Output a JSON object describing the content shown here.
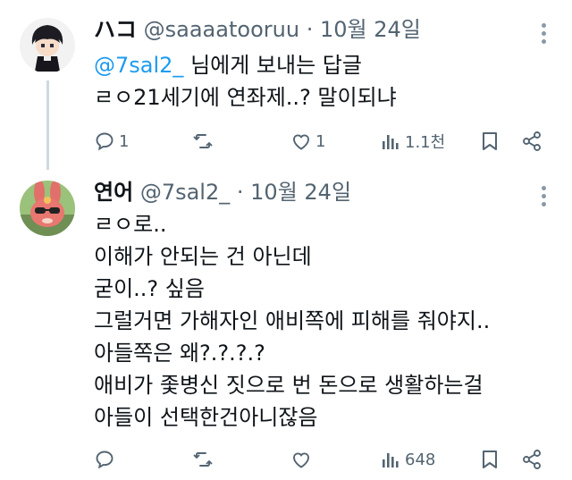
{
  "tweet1": {
    "name": "ハコ",
    "handle": "@saaaatooruu",
    "separator": "·",
    "date": "10월 24일",
    "reply_to_handle": "@7sal2_",
    "reply_to_suffix": "님에게 보내는 답글",
    "text": "ㄹㅇ21세기에 연좌제..? 말이되냐",
    "replies": "1",
    "retweets": "",
    "likes": "1",
    "views": "1.1천"
  },
  "tweet2": {
    "name": "연어",
    "handle": "@7sal2_",
    "separator": "·",
    "date": "10월 24일",
    "lines": [
      "ㄹㅇ로..",
      "이해가 안되는 건 아닌데",
      "굳이..? 싶음",
      "그럴거면 가해자인 애비쪽에 피해를 줘야지..",
      "아들쪽은 왜?.?.?.?",
      "애비가 좇병신 짓으로 번 돈으로 생활하는걸",
      "아들이 선택한건아니잖음"
    ],
    "replies": "",
    "retweets": "",
    "likes": "",
    "views": "648"
  },
  "colors": {
    "accent": "#1d9bf0",
    "meta_text": "#536471",
    "thread_line": "#cfd9de"
  },
  "icons": [
    "reply-icon",
    "retweet-icon",
    "like-icon",
    "views-icon",
    "bookmark-icon",
    "share-icon",
    "more-icon"
  ]
}
